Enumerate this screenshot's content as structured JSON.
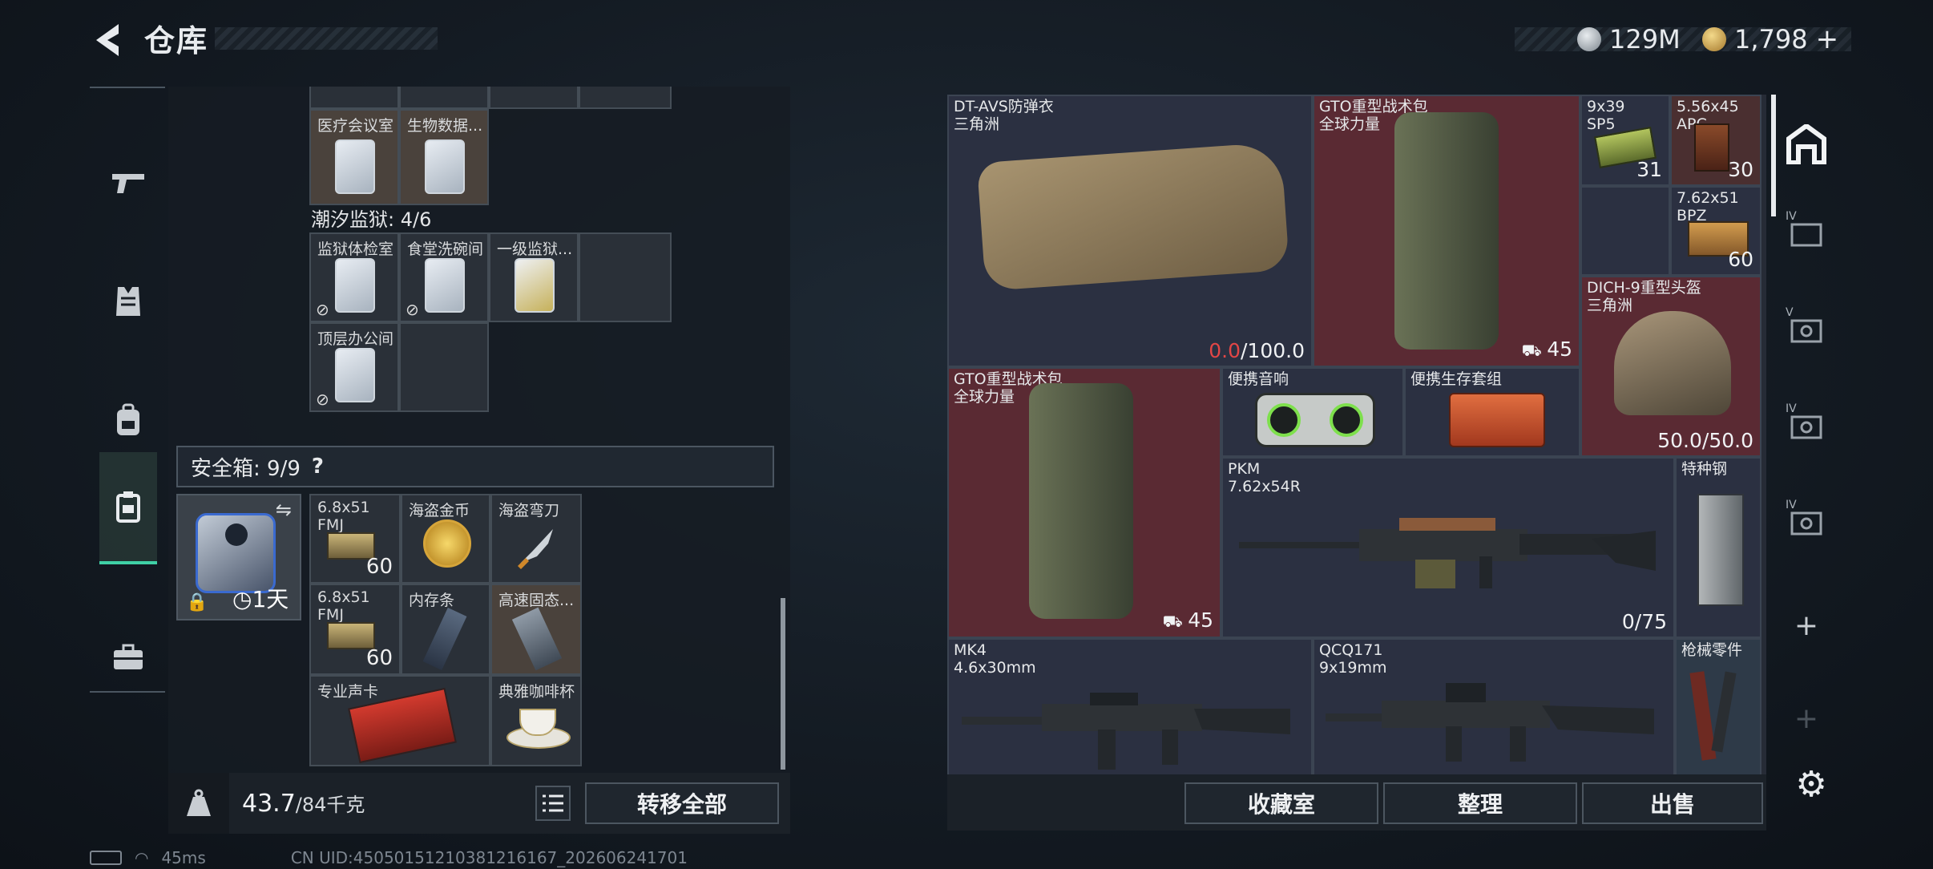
{
  "header": {
    "title": "仓库",
    "currency1": "129M",
    "currency2": "1,798",
    "plus": "+"
  },
  "left": {
    "partial_row1": [
      "医疗会议室",
      "生物数据..."
    ],
    "section2_title": "潮汐监狱: 4/6",
    "section2_items": [
      "监狱体检室",
      "食堂洗碗间",
      "一级监狱...",
      "顶层办公间"
    ],
    "safe_title": "安全箱: 9/9",
    "safe_help": "?",
    "safe_duration": "1天",
    "safe_items": [
      {
        "label": "6.8x51\nFMJ",
        "count": "60"
      },
      {
        "label": "海盗金币",
        "count": ""
      },
      {
        "label": "海盗弯刀",
        "count": ""
      },
      {
        "label": "6.8x51\nFMJ",
        "count": "60"
      },
      {
        "label": "内存条",
        "count": ""
      },
      {
        "label": "高速固态...",
        "count": ""
      },
      {
        "label": "专业声卡",
        "count": ""
      },
      {
        "label": "典雅咖啡杯",
        "count": ""
      }
    ],
    "weight": "43.7",
    "weight_max": "/84千克",
    "weight_icon_text": "KG",
    "transfer_all": "转移全部"
  },
  "right": {
    "items": [
      {
        "label": "DT-AVS防弹衣\n三角洲",
        "val_red": "0.0",
        "val": "/100.0"
      },
      {
        "label": "GTO重型战术包\n全球力量",
        "val": "45"
      },
      {
        "label": "9x39\nSP5",
        "val": "31"
      },
      {
        "label": "5.56x45\nAPC",
        "val": "30"
      },
      {
        "label": "7.62x51\nBPZ",
        "val": "60"
      },
      {
        "label": "DICH-9重型头盔\n三角洲",
        "val": "50.0/50.0"
      },
      {
        "label": "GTO重型战术包\n全球力量",
        "val": "45"
      },
      {
        "label": "便携音响",
        "val": ""
      },
      {
        "label": "便携生存套组",
        "val": ""
      },
      {
        "label": "PKM\n7.62x54R",
        "val": "0/75"
      },
      {
        "label": "特种钢",
        "val": ""
      },
      {
        "label": "MK4\n4.6x30mm",
        "val": ""
      },
      {
        "label": "QCQ171\n9x19mm",
        "val": ""
      },
      {
        "label": "枪械零件",
        "val": ""
      }
    ],
    "buttons": [
      "收藏室",
      "整理",
      "出售"
    ]
  },
  "rightnav": {
    "labels": [
      "IV",
      "V",
      "IV",
      "IV"
    ],
    "plus": "+"
  },
  "status": {
    "ping": "45ms",
    "uid": "CN UID:4505015121038121616​7_202606241701"
  }
}
